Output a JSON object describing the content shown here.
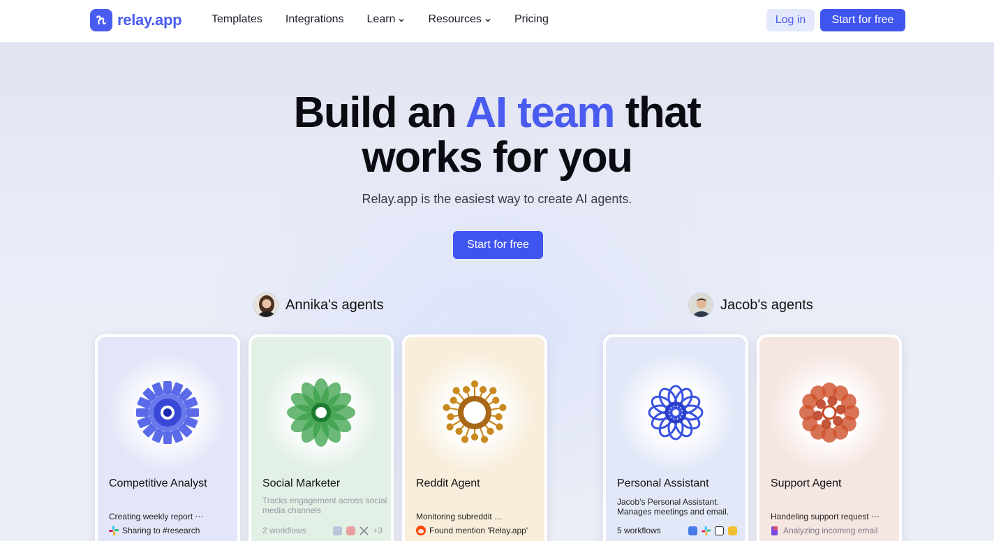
{
  "nav": {
    "logo_text": "relay.app",
    "links": [
      {
        "label": "Templates"
      },
      {
        "label": "Integrations"
      },
      {
        "label": "Learn"
      },
      {
        "label": "Resources"
      },
      {
        "label": "Pricing"
      }
    ],
    "login_label": "Log in",
    "start_label": "Start for free"
  },
  "hero": {
    "title_pre": "Build an ",
    "title_accent": "AI team",
    "title_post": " that",
    "title_line2": "works for you",
    "subtitle": "Relay.app is the easiest way to create AI agents.",
    "cta_label": "Start for free"
  },
  "owners": [
    {
      "name": "Annika's agents"
    },
    {
      "name": "Jacob's agents"
    }
  ],
  "cards": [
    {
      "title": "Competitive Analyst",
      "desc": "",
      "status": "Creating weekly report ⋯",
      "substatus": "Sharing to #research",
      "bg": "#e3e6f8",
      "color": "#4a5ae0"
    },
    {
      "title": "Social Marketer",
      "desc": "Tracks engagement across social media channels",
      "workflows": "2 workflows",
      "extra": "+3",
      "bg": "#e2f0e6",
      "color": "#3aa04a"
    },
    {
      "title": "Reddit Agent",
      "desc": "",
      "status": "Monitoring subreddit …",
      "substatus": "Found mention 'Relay.app'",
      "bg": "#f8eedb",
      "color": "#c88a20"
    },
    {
      "title": "Personal Assistant",
      "desc": "Jacob’s Personal Assistant. Manages meetings and email.",
      "workflows": "5 workflows",
      "bg": "#e2e8f8",
      "color": "#3a52e0"
    },
    {
      "title": "Support Agent",
      "desc": "",
      "status": "Handeling support request ⋯",
      "substatus": "Analyzing incoming email",
      "bg": "#f6e6e2",
      "color": "#c8482a"
    }
  ]
}
